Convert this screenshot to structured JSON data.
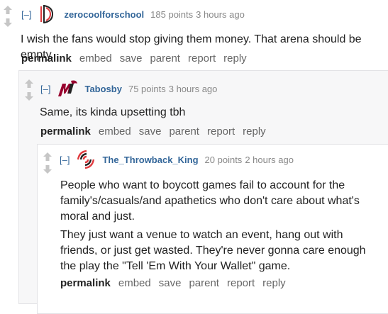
{
  "comments": [
    {
      "collapse": "[–]",
      "author": "zerocoolforschool",
      "score": "185 points",
      "time": "3 hours ago",
      "paragraphs": [
        "I wish the fans would stop giving them money. That arena should be empty."
      ],
      "avatar_icon": "blazers-pinwheel-icon"
    },
    {
      "collapse": "[–]",
      "author": "Tabosby",
      "score": "75 points",
      "time": "3 hours ago",
      "paragraphs": [
        "Same, its kinda upsetting tbh"
      ],
      "avatar_icon": "heat-logo-icon"
    },
    {
      "collapse": "[–]",
      "author": "The_Throwback_King",
      "score": "20 points",
      "time": "2 hours ago",
      "paragraphs": [
        "People who want to boycott games fail to account for the family's/casuals/and apathetics who don't care about what's moral and just.",
        "They just want a venue to watch an event, hang out with friends, or just get wasted. They're never gonna care enough the play the \"Tell 'Em With Your Wallet\" game."
      ],
      "avatar_icon": "blazers-pinwheel-icon"
    }
  ],
  "actions": {
    "permalink": "permalink",
    "embed": "embed",
    "save": "save",
    "parent": "parent",
    "report": "report",
    "reply": "reply"
  },
  "colors": {
    "author": "#336699",
    "meta": "#888888",
    "arrow": "#c6c6c6",
    "blazers_red": "#e03a3e",
    "heat_red": "#98002e"
  }
}
